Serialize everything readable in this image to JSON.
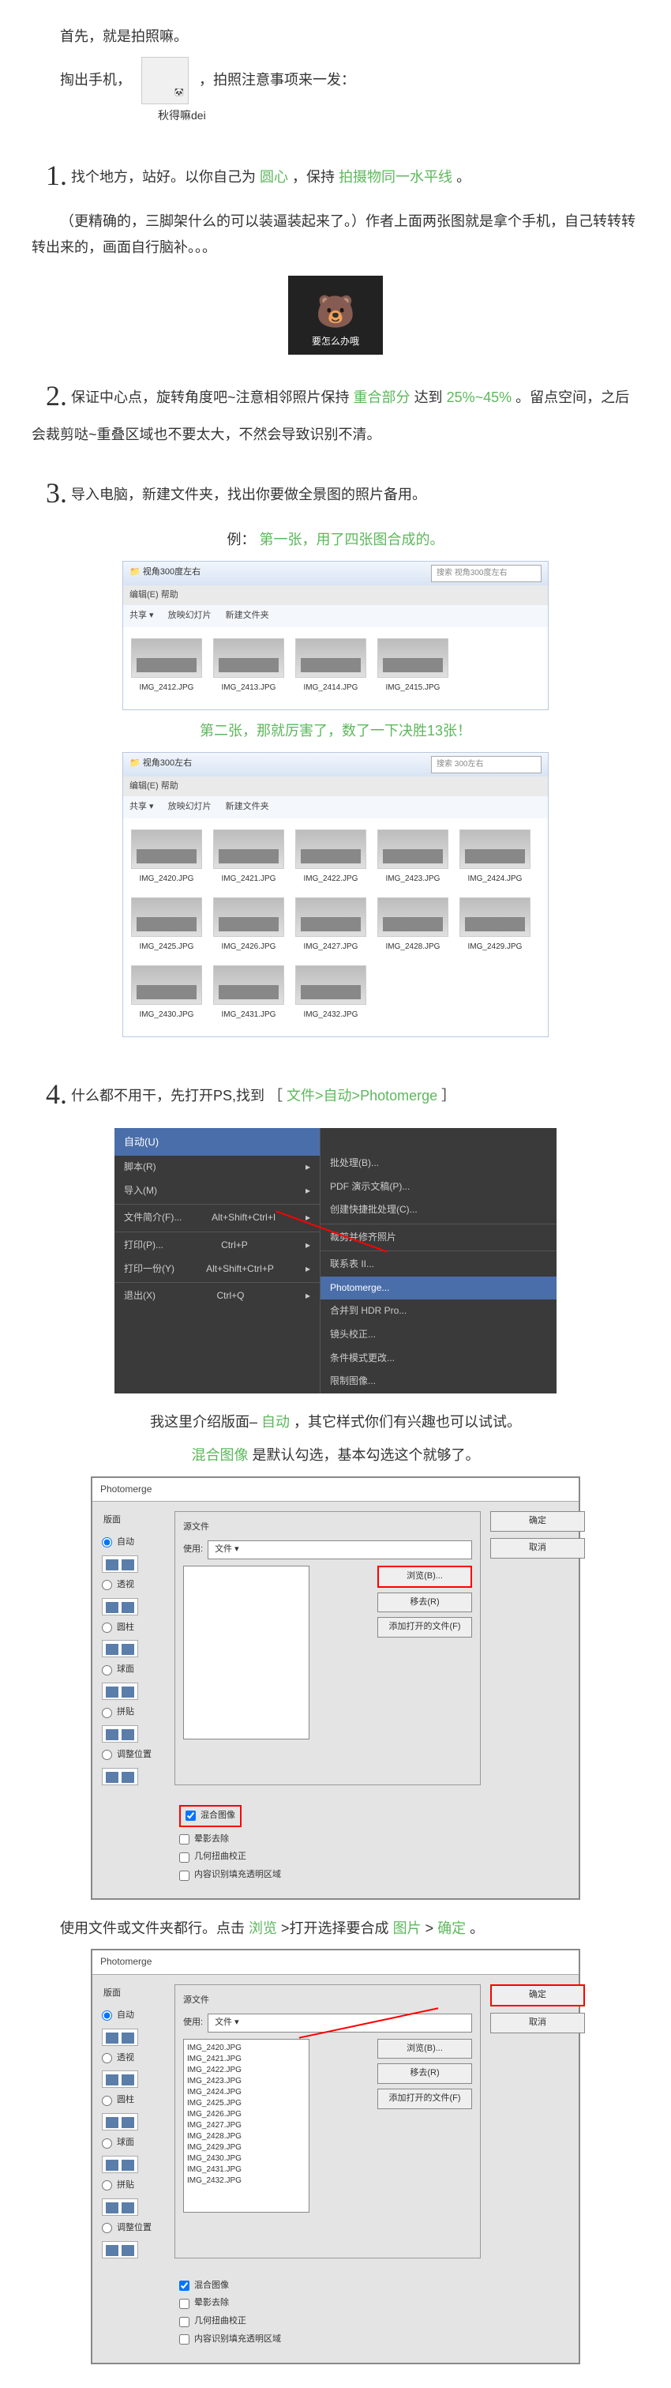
{
  "intro": {
    "p1": "首先，就是拍照嘛。",
    "p2a": "掏出手机，",
    "p2b": "，拍照注意事项来一发：",
    "emoji_label": "秋得嘛dei"
  },
  "step1": {
    "num": "1.",
    "t1": "找个地方，站好。以你自己为",
    "g1": "圆心",
    "t2": "，保持",
    "g2": "拍摄物同一水平线",
    "t3": "。",
    "p2": "（更精确的，三脚架什么的可以装逼装起来了。）作者上面两张图就是拿个手机，自己转转转转出来的，画面自行脑补。。。",
    "bear_text": "要怎么办哦"
  },
  "step2": {
    "num": "2.",
    "t1": "保证中心点，旋转角度吧~注意相邻照片保持",
    "g1": "重合部分",
    "t2": "达到",
    "g2": "25%~45%",
    "t3": "。留点空间，之后会裁剪哒~重叠区域也不要太大，不然会导致识别不清。"
  },
  "step3": {
    "num": "3.",
    "t1": "导入电脑，新建文件夹，找出你要做全景图的照片备用。",
    "ex1_a": "例：",
    "ex1_b": "第一张，用了四张图合成的。",
    "browser1": {
      "title": "视角300度左右",
      "search": "搜索 视角300度左右",
      "menu": "编辑(E)  帮助",
      "tb1": "共享 ▾",
      "tb2": "放映幻灯片",
      "tb3": "新建文件夹",
      "files": [
        "IMG_2412.JPG",
        "IMG_2413.JPG",
        "IMG_2414.JPG",
        "IMG_2415.JPG"
      ]
    },
    "ex2": "第二张，那就厉害了，数了一下决胜13张！",
    "browser2": {
      "title": "视角300左右",
      "search": "搜索 300左右",
      "menu": "编辑(E)  帮助",
      "tb1": "共享 ▾",
      "tb2": "放映幻灯片",
      "tb3": "新建文件夹",
      "files": [
        "IMG_2420.JPG",
        "IMG_2421.JPG",
        "IMG_2422.JPG",
        "IMG_2423.JPG",
        "IMG_2424.JPG",
        "IMG_2425.JPG",
        "IMG_2426.JPG",
        "IMG_2427.JPG",
        "IMG_2428.JPG",
        "IMG_2429.JPG",
        "IMG_2430.JPG",
        "IMG_2431.JPG",
        "IMG_2432.JPG"
      ]
    }
  },
  "step4": {
    "num": "4.",
    "t1": "什么都不用干，先打开PS,找到 ［",
    "g1": "文件>自动>Photomerge",
    "t2": "］",
    "psmenu": {
      "head": "自动(U)",
      "left": [
        {
          "l": "脚本(R)",
          "k": ""
        },
        {
          "l": "导入(M)",
          "k": ""
        },
        {
          "sep": true
        },
        {
          "l": "文件简介(F)...",
          "k": "Alt+Shift+Ctrl+I"
        },
        {
          "sep": true
        },
        {
          "l": "打印(P)...",
          "k": "Ctrl+P"
        },
        {
          "l": "打印一份(Y)",
          "k": "Alt+Shift+Ctrl+P"
        },
        {
          "sep": true
        },
        {
          "l": "退出(X)",
          "k": "Ctrl+Q"
        }
      ],
      "right": [
        "批处理(B)...",
        "PDF 演示文稿(P)...",
        "创建快捷批处理(C)...",
        "__sep",
        "裁剪并修齐照片",
        "__sep",
        "联系表 II...",
        "__hi:Photomerge...",
        "合并到 HDR Pro...",
        "镜头校正...",
        "条件模式更改...",
        "限制图像..."
      ]
    },
    "p2a": "我这里介绍版面–",
    "p2g": "自动",
    "p2b": "，其它样式你们有兴趣也可以试试。",
    "p3a": "混合图像",
    "p3b": "是默认勾选，基本勾选这个就够了。"
  },
  "dialog1": {
    "title": "Photomerge",
    "left_label": "版面",
    "opts": [
      "自动",
      "透视",
      "圆柱",
      "球面",
      "拼贴",
      "调整位置"
    ],
    "mid_label": "源文件",
    "use_label": "使用:",
    "use_value": "文件",
    "browse": "浏览(B)...",
    "remove": "移去(R)",
    "addopen": "添加打开的文件(F)",
    "ok": "确定",
    "cancel": "取消",
    "chk1": "混合图像",
    "chk2": "晕影去除",
    "chk3": "几何扭曲校正",
    "chk4": "内容识别填充透明区域"
  },
  "mid_text": {
    "a": "使用文件或文件夹都行。点击",
    "g1": "浏览",
    "b": ">打开选择要合成",
    "g2": "图片",
    "c": ">",
    "g3": "确定",
    "d": "。"
  },
  "dialog2": {
    "files": [
      "IMG_2420.JPG",
      "IMG_2421.JPG",
      "IMG_2422.JPG",
      "IMG_2423.JPG",
      "IMG_2424.JPG",
      "IMG_2425.JPG",
      "IMG_2426.JPG",
      "IMG_2427.JPG",
      "IMG_2428.JPG",
      "IMG_2429.JPG",
      "IMG_2430.JPG",
      "IMG_2431.JPG",
      "IMG_2432.JPG"
    ]
  }
}
